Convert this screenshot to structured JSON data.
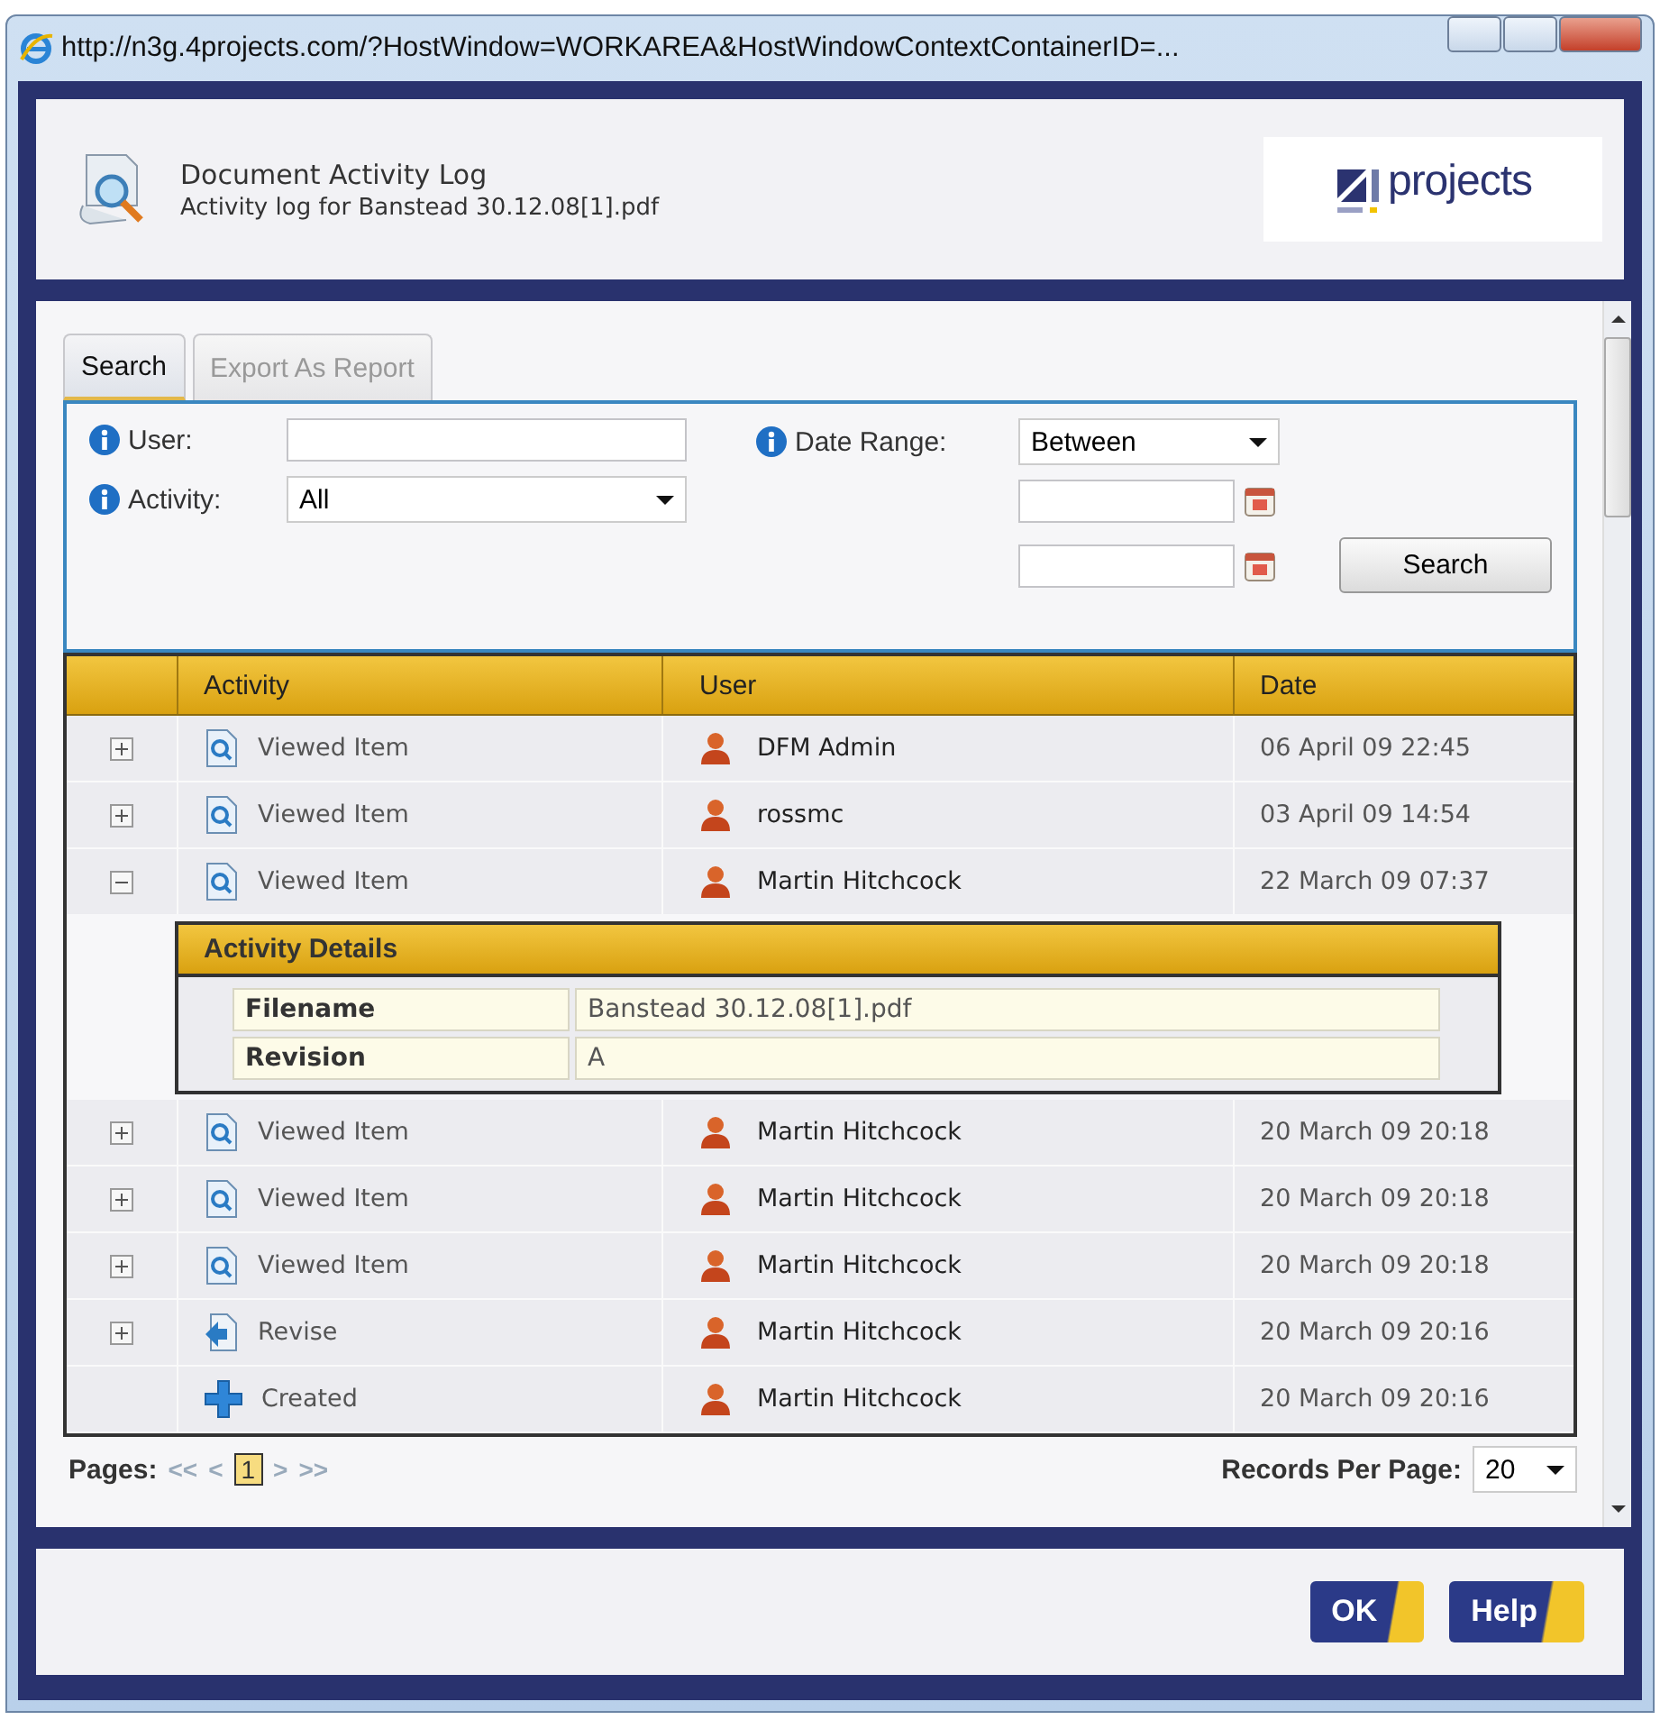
{
  "window": {
    "title": "http://n3g.4projects.com/?HostWindow=WORKAREA&HostWindowContextContainerID=..."
  },
  "header": {
    "title": "Document Activity Log",
    "subtitle": "Activity log for Banstead 30.12.08[1].pdf",
    "logo_text": "projects"
  },
  "tabs": [
    {
      "label": "Search",
      "selected": true
    },
    {
      "label": "Export As Report",
      "selected": false
    }
  ],
  "search": {
    "user_label": "User:",
    "activity_label": "Activity:",
    "activity_value": "All",
    "date_range_label": "Date Range:",
    "date_range_value": "Between",
    "button": "Search"
  },
  "table": {
    "columns": [
      "Activity",
      "User",
      "Date"
    ],
    "rows": [
      {
        "activity": "Viewed Item",
        "kind": "view",
        "user": "DFM Admin",
        "date": "06 April 09 22:45",
        "expandable": true,
        "expanded": false
      },
      {
        "activity": "Viewed Item",
        "kind": "view",
        "user": "rossmc",
        "date": "03 April 09 14:54",
        "expandable": true,
        "expanded": false
      },
      {
        "activity": "Viewed Item",
        "kind": "view",
        "user": "Martin Hitchcock",
        "date": "22 March 09 07:37",
        "expandable": true,
        "expanded": true,
        "details": {
          "title": "Activity Details",
          "fields": [
            {
              "label": "Filename",
              "value": "Banstead 30.12.08[1].pdf"
            },
            {
              "label": "Revision",
              "value": "A"
            }
          ]
        }
      },
      {
        "activity": "Viewed Item",
        "kind": "view",
        "user": "Martin Hitchcock",
        "date": "20 March 09 20:18",
        "expandable": true,
        "expanded": false
      },
      {
        "activity": "Viewed Item",
        "kind": "view",
        "user": "Martin Hitchcock",
        "date": "20 March 09 20:18",
        "expandable": true,
        "expanded": false
      },
      {
        "activity": "Viewed Item",
        "kind": "view",
        "user": "Martin Hitchcock",
        "date": "20 March 09 20:18",
        "expandable": true,
        "expanded": false
      },
      {
        "activity": "Revise",
        "kind": "revise",
        "user": "Martin Hitchcock",
        "date": "20 March 09 20:16",
        "expandable": true,
        "expanded": false
      },
      {
        "activity": "Created",
        "kind": "create",
        "user": "Martin Hitchcock",
        "date": "20 March 09 20:16",
        "expandable": false
      }
    ]
  },
  "pager": {
    "label": "Pages:",
    "first": "<<",
    "prev": "<",
    "pages": [
      {
        "label": "1",
        "selected": true
      }
    ],
    "next": ">",
    "last": ">>",
    "records_label": "Records Per Page:",
    "records_value": "20"
  },
  "buttons": [
    "OK",
    "Help"
  ]
}
